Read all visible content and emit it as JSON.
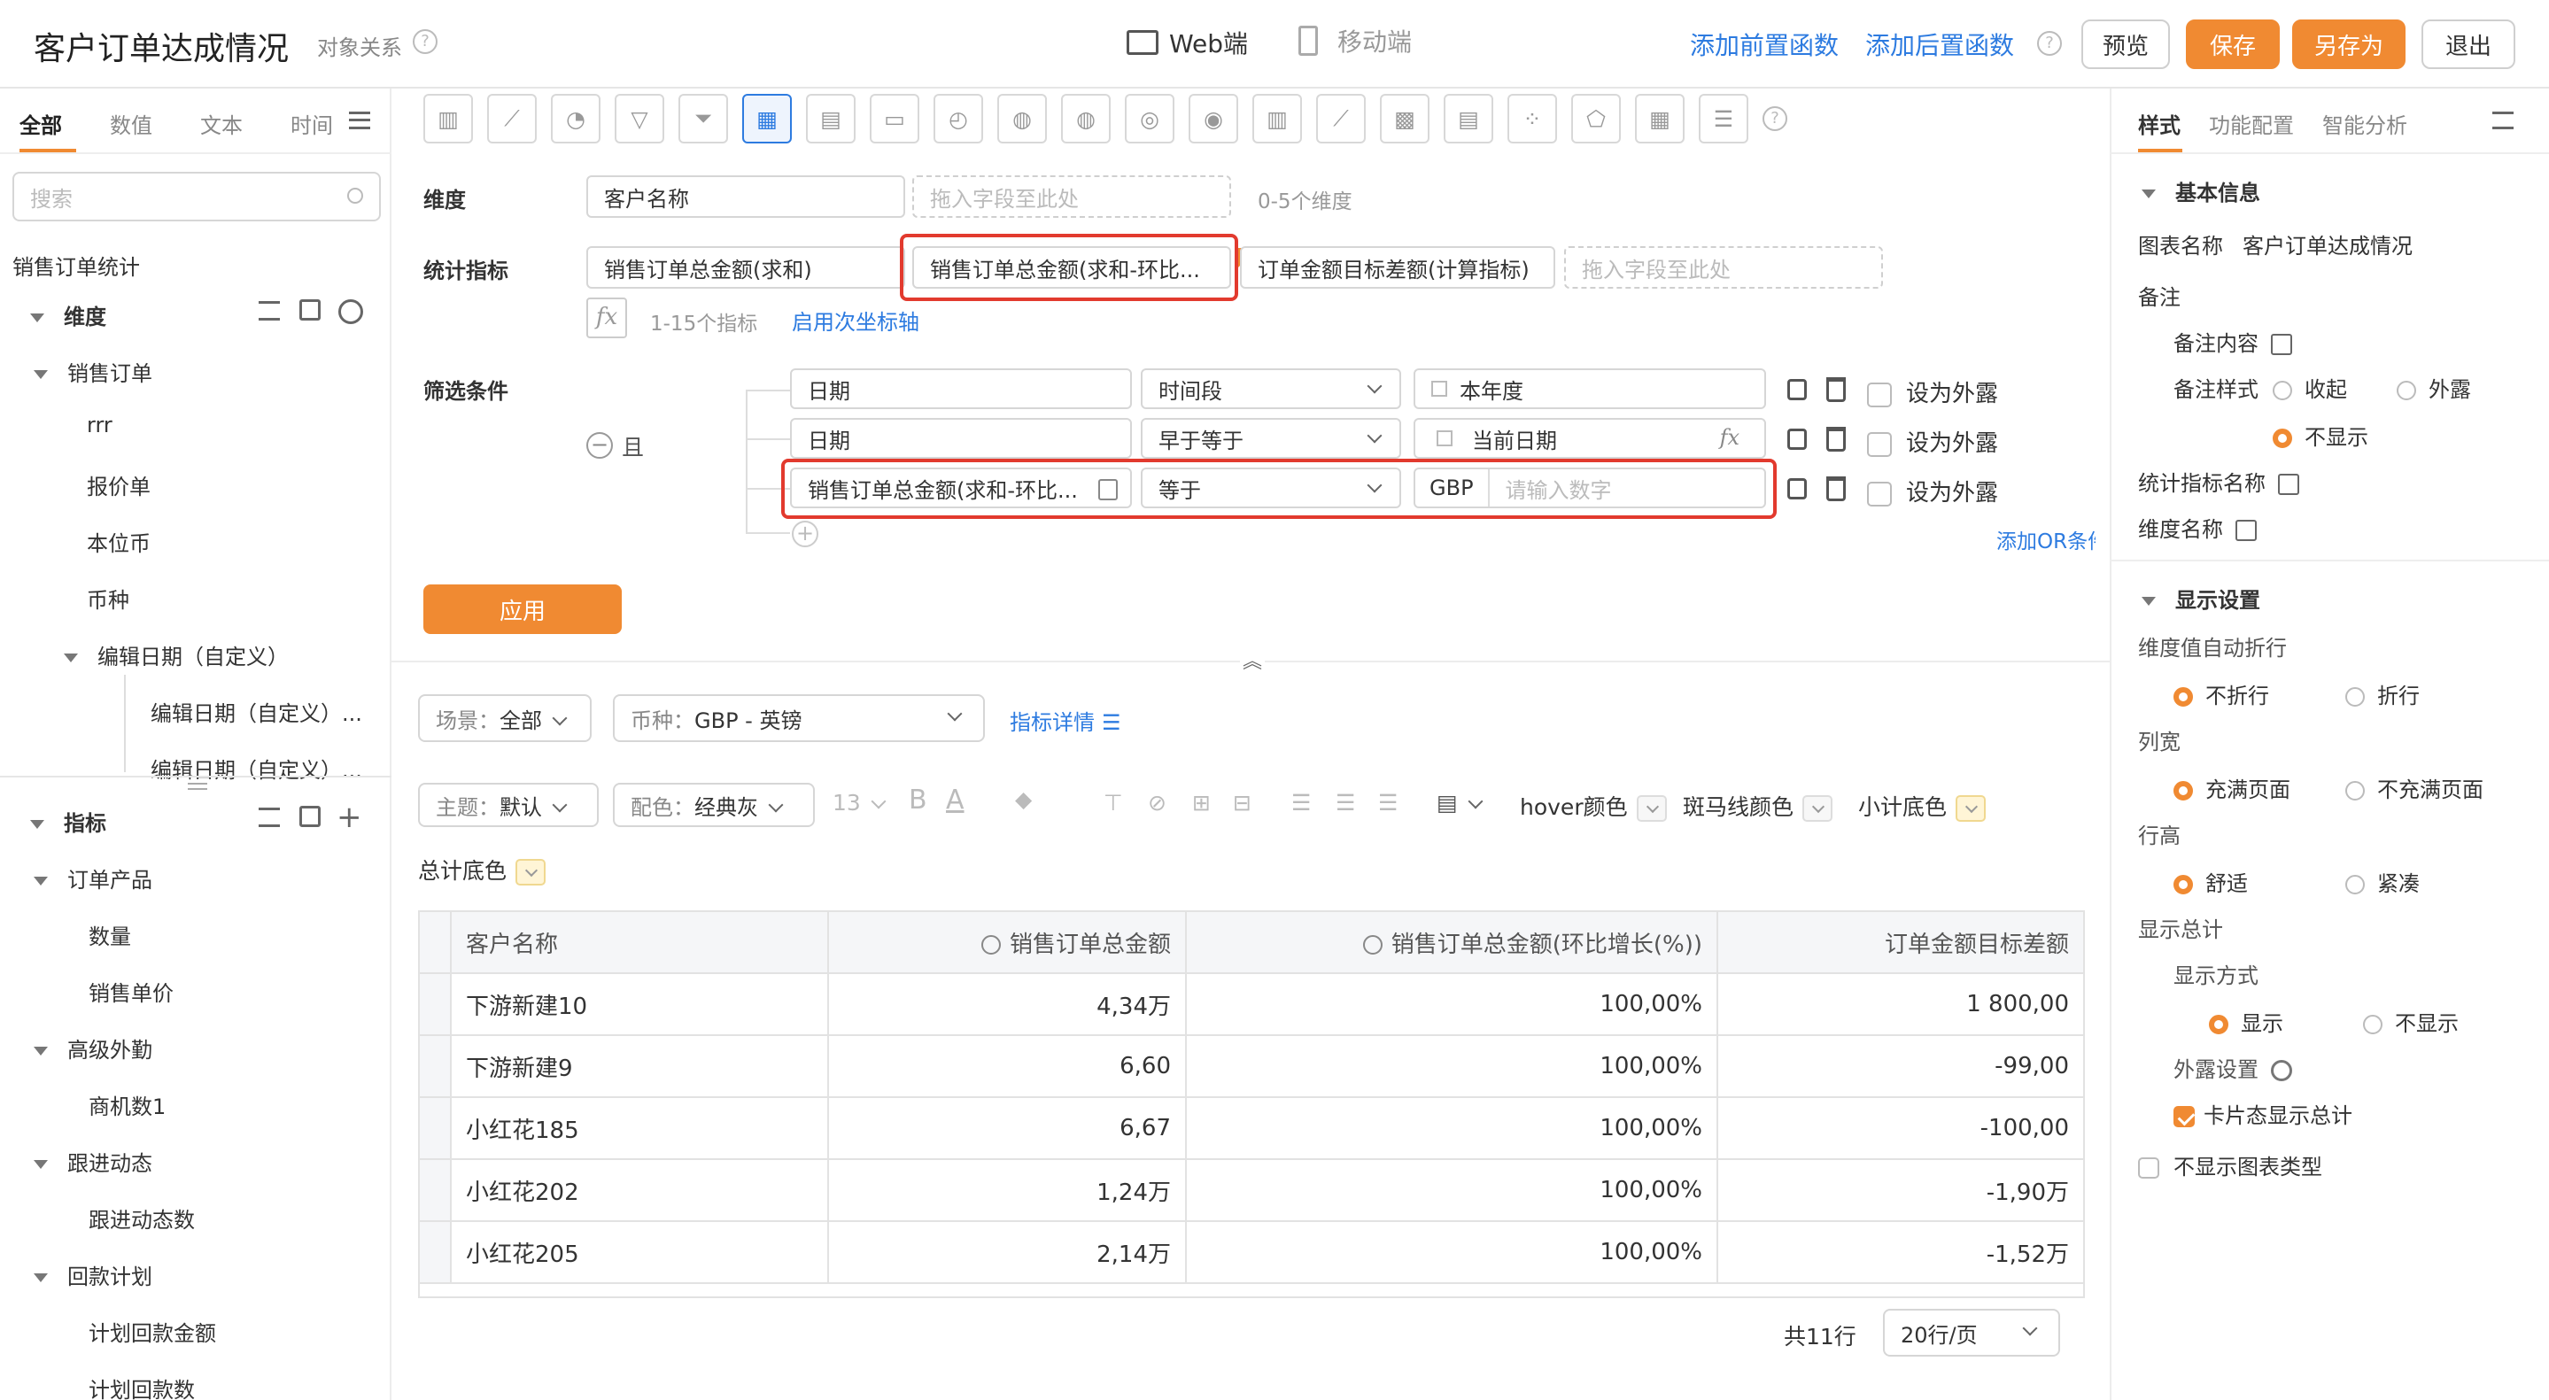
{
  "header": {
    "title": "客户订单达成情况",
    "relation": "对象关系",
    "web": "Web端",
    "mobile": "移动端",
    "add_pre": "添加前置函数",
    "add_post": "添加后置函数",
    "preview": "预览",
    "save": "保存",
    "save_as": "另存为",
    "exit": "退出"
  },
  "left": {
    "tabs": [
      "全部",
      "数值",
      "文本",
      "时间"
    ],
    "search_placeholder": "搜索",
    "dataset": "销售订单统计",
    "dim_header": "维度",
    "metric_header": "指标",
    "dim_items": [
      {
        "label": "销售订单",
        "level": 1
      },
      {
        "label": "rrr",
        "level": 2
      },
      {
        "label": "报价单",
        "level": 2
      },
      {
        "label": "本位币",
        "level": 2
      },
      {
        "label": "币种",
        "level": 2
      },
      {
        "label": "编辑日期（自定义）",
        "level": 1.5
      },
      {
        "label": "编辑日期（自定义）...",
        "level": 3
      },
      {
        "label": "编辑日期（自定义）...",
        "level": 3
      }
    ],
    "metric_items": [
      {
        "label": "订单产品",
        "level": 1
      },
      {
        "label": "数量",
        "level": 2
      },
      {
        "label": "销售单价",
        "level": 2
      },
      {
        "label": "高级外勤",
        "level": 1
      },
      {
        "label": "商机数1",
        "level": 2
      },
      {
        "label": "跟进动态",
        "level": 1
      },
      {
        "label": "跟进动态数",
        "level": 2
      },
      {
        "label": "回款计划",
        "level": 1
      },
      {
        "label": "计划回款金额",
        "level": 2
      },
      {
        "label": "计划回款数",
        "level": 2
      }
    ]
  },
  "config": {
    "dim_label": "维度",
    "dim_value": "客户名称",
    "drop_here": "拖入字段至此处",
    "dim_hint": "0-5个维度",
    "metric_label": "统计指标",
    "metrics": [
      "销售订单总金额(求和)",
      "销售订单总金额(求和-环比...",
      "订单金额目标差额(计算指标)"
    ],
    "metric_hint": "1-15个指标",
    "secondary_axis": "启用次坐标轴",
    "filter_label": "筛选条件",
    "and": "且",
    "set_external": "设为外露",
    "add_or": "添加OR条件",
    "filters": [
      {
        "field": "日期",
        "op": "时间段",
        "value": "本年度"
      },
      {
        "field": "日期",
        "op": "早于等于",
        "value": "当前日期"
      },
      {
        "field": "销售订单总金额(求和-环比...",
        "op": "等于",
        "prefix": "GBP",
        "placeholder": "请输入数字"
      }
    ],
    "apply": "应用"
  },
  "toolbar": {
    "scene_label": "场景：",
    "scene_value": "全部",
    "currency_label": "币种：",
    "currency_value": "GBP - 英镑",
    "metric_detail": "指标详情",
    "theme_label": "主题：",
    "theme_value": "默认",
    "palette_label": "配色：",
    "palette_value": "经典灰",
    "font_size": "13",
    "hover": "hover颜色",
    "zebra": "斑马线颜色",
    "subtotal": "小计底色",
    "total": "总计底色"
  },
  "table": {
    "headers": [
      "客户名称",
      "销售订单总金额",
      "销售订单总金额(环比增长(%))",
      "订单金额目标差额"
    ],
    "rows": [
      [
        "下游新建10",
        "4,34万",
        "100,00%",
        "1 800,00"
      ],
      [
        "下游新建9",
        "6,60",
        "100,00%",
        "-99,00"
      ],
      [
        "小红花185",
        "6,67",
        "100,00%",
        "-100,00"
      ],
      [
        "小红花202",
        "1,24万",
        "100,00%",
        "-1,90万"
      ],
      [
        "小红花205",
        "2,14万",
        "100,00%",
        "-1,52万"
      ]
    ],
    "total": "共11行",
    "page_size": "20行/页"
  },
  "right": {
    "tabs": [
      "样式",
      "功能配置",
      "智能分析"
    ],
    "basic": "基本信息",
    "chart_name_label": "图表名称",
    "chart_name": "客户订单达成情况",
    "note": "备注",
    "note_content": "备注内容",
    "note_style": "备注样式",
    "collapse": "收起",
    "external": "外露",
    "hide": "不显示",
    "metric_name": "统计指标名称",
    "dim_name": "维度名称",
    "display": "显示设置",
    "auto_wrap": "维度值自动折行",
    "no_wrap": "不折行",
    "wrap": "折行",
    "col_width": "列宽",
    "fill": "充满页面",
    "no_fill": "不充满页面",
    "row_height": "行高",
    "comfortable": "舒适",
    "compact": "紧凑",
    "show_total": "显示总计",
    "show_mode": "显示方式",
    "show": "显示",
    "no_show": "不显示",
    "ext_setting": "外露设置",
    "card_total": "卡片态显示总计",
    "hide_type": "不显示图表类型"
  }
}
